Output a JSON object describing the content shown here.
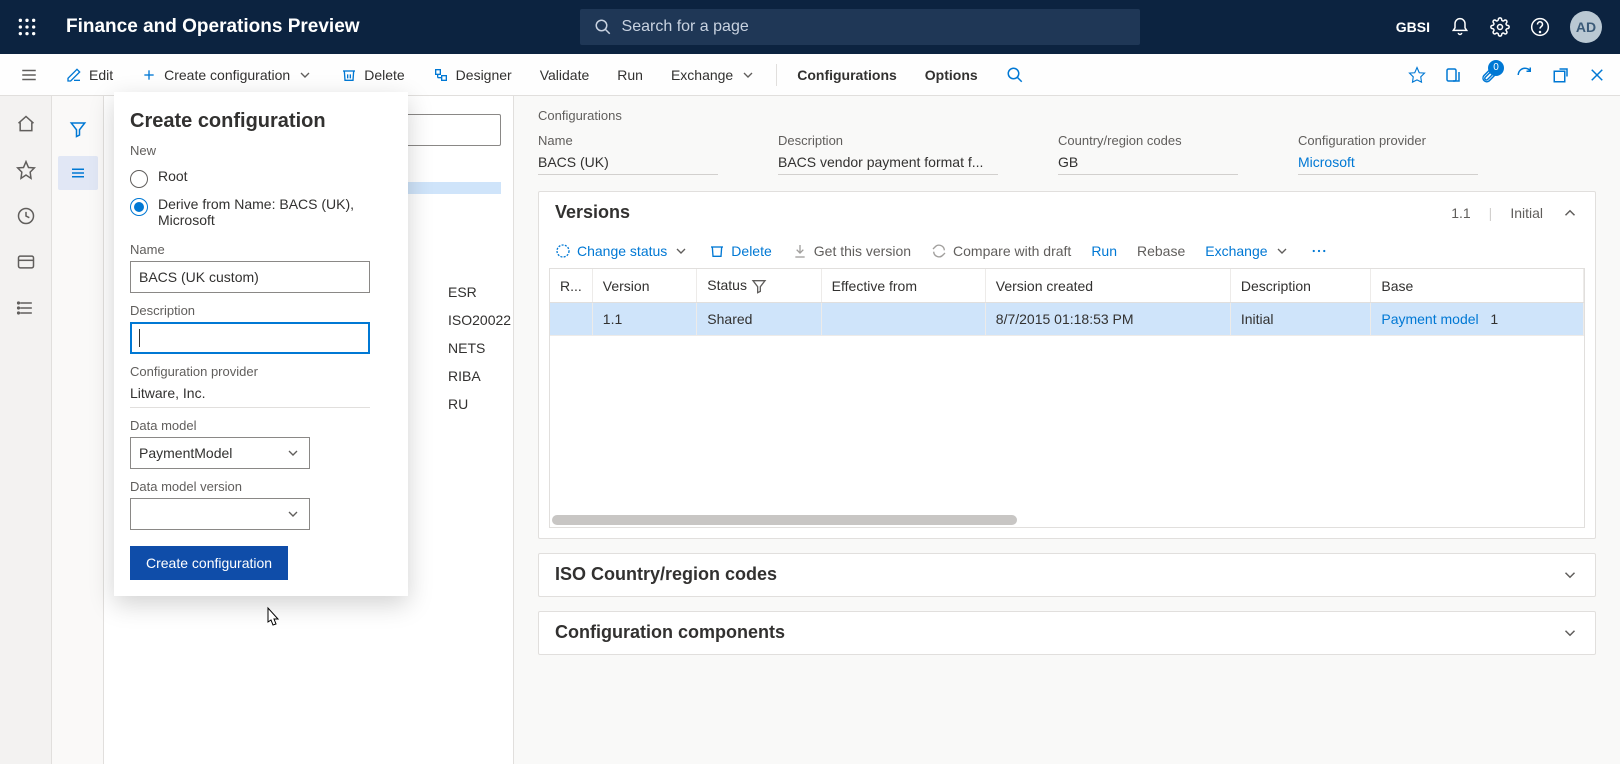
{
  "topbar": {
    "title": "Finance and Operations Preview",
    "search_placeholder": "Search for a page",
    "org": "GBSI",
    "avatar": "AD"
  },
  "commands": {
    "edit": "Edit",
    "create_config": "Create configuration",
    "delete": "Delete",
    "designer": "Designer",
    "validate": "Validate",
    "run": "Run",
    "exchange": "Exchange",
    "configurations": "Configurations",
    "options": "Options",
    "badge_count": "0"
  },
  "tree": {
    "visible_items": [
      "ESR",
      "ISO20022",
      "NETS",
      "RIBA",
      "RU"
    ]
  },
  "create_panel": {
    "title": "Create configuration",
    "section_new": "New",
    "root": "Root",
    "derive": "Derive from Name: BACS (UK), Microsoft",
    "labels": {
      "name": "Name",
      "desc": "Description",
      "prov": "Configuration provider",
      "model": "Data model",
      "model_ver": "Data model version"
    },
    "name_value": "BACS (UK custom)",
    "desc_value": "",
    "provider_value": "Litware, Inc.",
    "data_model_value": "PaymentModel",
    "data_model_version_value": "",
    "submit": "Create configuration"
  },
  "details": {
    "breadcrumb": "Configurations",
    "fields": {
      "name": {
        "label": "Name",
        "value": "BACS (UK)"
      },
      "desc": {
        "label": "Description",
        "value": "BACS vendor payment format f..."
      },
      "region": {
        "label": "Country/region codes",
        "value": "GB"
      },
      "provider": {
        "label": "Configuration provider",
        "value": "Microsoft"
      }
    }
  },
  "versions": {
    "title": "Versions",
    "head_version": "1.1",
    "head_state": "Initial",
    "actions": {
      "change": "Change status",
      "delete": "Delete",
      "get": "Get this version",
      "compare": "Compare with draft",
      "run": "Run",
      "rebase": "Rebase",
      "exchange": "Exchange"
    },
    "columns": {
      "r": "R...",
      "version": "Version",
      "status": "Status",
      "effective": "Effective from",
      "created": "Version created",
      "desc": "Description",
      "base": "Base"
    },
    "rows": [
      {
        "version": "1.1",
        "status": "Shared",
        "effective": "",
        "created": "8/7/2015 01:18:53 PM",
        "desc": "Initial",
        "base": "Payment model",
        "base_ver": "1"
      }
    ]
  },
  "collapsed_cards": {
    "iso": "ISO Country/region codes",
    "components": "Configuration components"
  }
}
